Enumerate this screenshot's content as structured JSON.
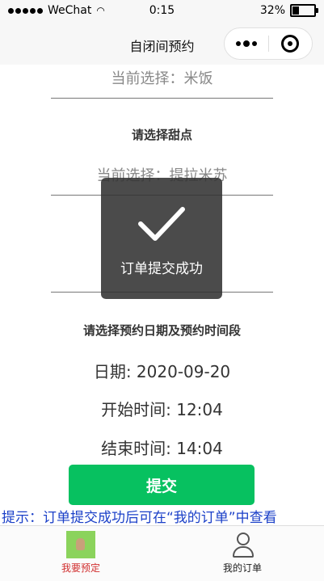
{
  "status_bar": {
    "carrier": "WeChat",
    "time": "0:15",
    "battery": "32%",
    "battery_level": 0.32
  },
  "nav": {
    "title": "自闭间预约"
  },
  "form": {
    "main_picker": "当前选择：米饭",
    "dessert_title": "请选择甜点",
    "dessert_picker": "当前选择：提拉米苏",
    "drink_picker": "",
    "date_title": "请选择预约日期及预约时间段",
    "date": "日期: 2020-09-20",
    "start_time": "开始时间: 12:04",
    "end_time": "结束时间: 14:04",
    "submit_label": "提交",
    "hint": "提示：订单提交成功后可在“我的订单”中查看"
  },
  "toast": {
    "message": "订单提交成功",
    "icon": "checkmark-icon"
  },
  "tabbar": {
    "items": [
      {
        "label": "我要预定",
        "icon": "hand-icon",
        "active": true
      },
      {
        "label": "我的订单",
        "icon": "user-icon",
        "active": false
      }
    ]
  },
  "colors": {
    "primary": "#07c160",
    "hint": "#1b40c8",
    "active_tab": "#d12f2f"
  }
}
